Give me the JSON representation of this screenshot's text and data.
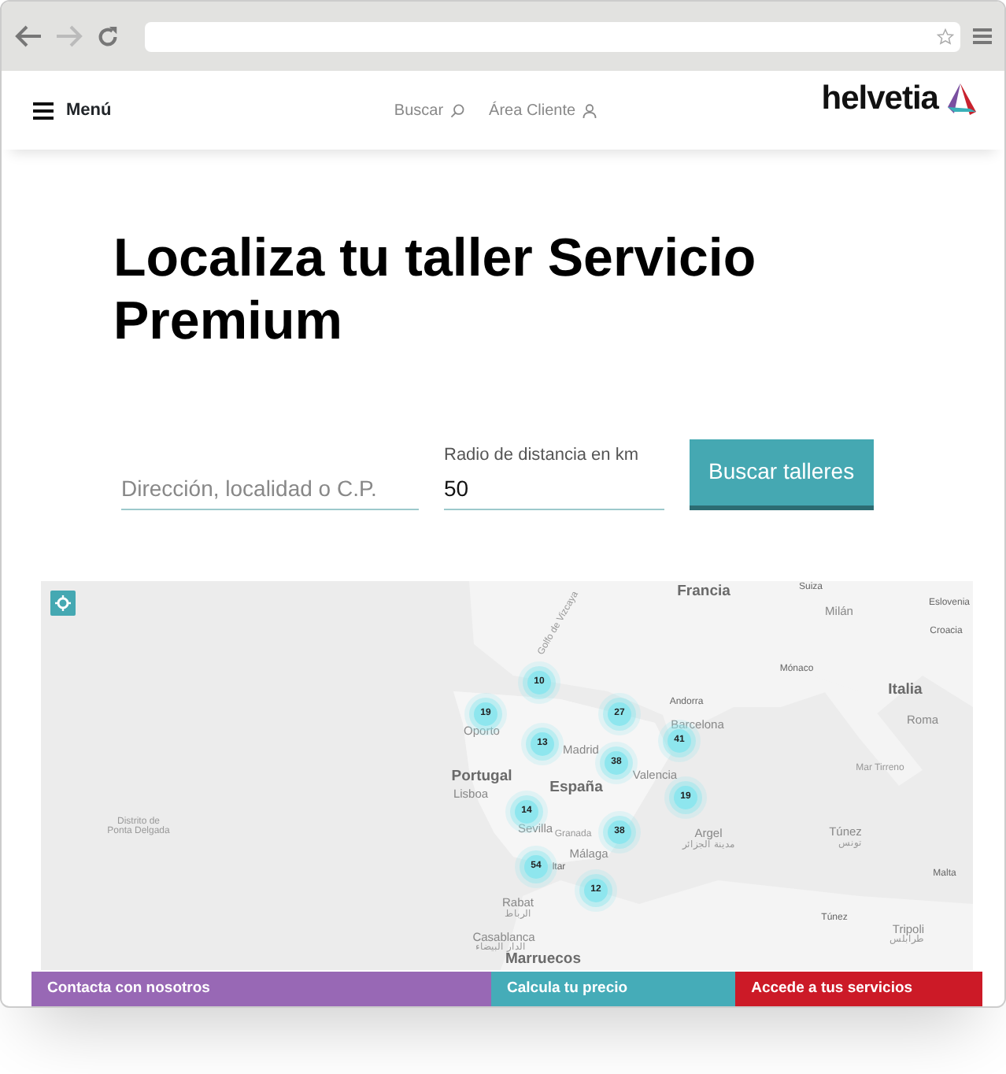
{
  "header": {
    "menu_label": "Menú",
    "links": [
      "Buscar",
      "Área Cliente"
    ],
    "logo": "helvetia"
  },
  "title": "Localiza tu taller Servicio Premium",
  "search": {
    "address_placeholder": "Dirección, localidad o C.P.",
    "radius_label": "Radio de distancia en km",
    "radius_value": "50",
    "button": "Buscar talleres"
  },
  "map": {
    "labels": [
      {
        "text": "Francia",
        "kind": "country"
      },
      {
        "text": "Suiza",
        "kind": "small"
      },
      {
        "text": "Eslovenia",
        "kind": "small"
      },
      {
        "text": "Milán",
        "kind": "city"
      },
      {
        "text": "Golfo de Vizcaya",
        "kind": "rotated"
      },
      {
        "text": "Croacia",
        "kind": "small"
      },
      {
        "text": "Mónaco",
        "kind": "small"
      },
      {
        "text": "Italia",
        "kind": "country"
      },
      {
        "text": "Andorra",
        "kind": "small"
      },
      {
        "text": "Roma",
        "kind": "city"
      },
      {
        "text": "Barcelona",
        "kind": "city"
      },
      {
        "text": "Oporto",
        "kind": "city"
      },
      {
        "text": "Madrid",
        "kind": "city"
      },
      {
        "text": "Mar Tirreno",
        "kind": "sea"
      },
      {
        "text": "Valencia",
        "kind": "city"
      },
      {
        "text": "Portugal",
        "kind": "country"
      },
      {
        "text": "España",
        "kind": "country"
      },
      {
        "text": "Lisboa",
        "kind": "city"
      },
      {
        "text": "Distrito de",
        "kind": "sea"
      },
      {
        "text": "Ponta Delgada",
        "kind": "sea"
      },
      {
        "text": "Sevilla",
        "kind": "city"
      },
      {
        "text": "Granada",
        "kind": "sea"
      },
      {
        "text": "Argel",
        "kind": "city"
      },
      {
        "text": "Túnez",
        "kind": "city"
      },
      {
        "text": "مدينة الجزائر",
        "kind": "sea"
      },
      {
        "text": "تونس",
        "kind": "sea"
      },
      {
        "text": "Málaga",
        "kind": "city"
      },
      {
        "text": "ltar",
        "kind": "small"
      },
      {
        "text": "Malta",
        "kind": "small"
      },
      {
        "text": "Rabat",
        "kind": "city"
      },
      {
        "text": "الرباط",
        "kind": "sea"
      },
      {
        "text": "Túnez",
        "kind": "small"
      },
      {
        "text": "Tripoli",
        "kind": "city"
      },
      {
        "text": "طرابلس",
        "kind": "sea"
      },
      {
        "text": "Casablanca",
        "kind": "city"
      },
      {
        "text": "الدار البيضاء",
        "kind": "sea"
      },
      {
        "text": "Marruecos",
        "kind": "country"
      }
    ],
    "clusters": [
      "10",
      "19",
      "27",
      "13",
      "41",
      "38",
      "19",
      "14",
      "38",
      "54",
      "12"
    ]
  },
  "bottom_bar": [
    {
      "label": "Contacta con nosotros",
      "color": "#9868b5"
    },
    {
      "label": "Calcula tu precio",
      "color": "#45acb8"
    },
    {
      "label": "Accede a tus servicios",
      "color": "#cc1a27"
    }
  ]
}
